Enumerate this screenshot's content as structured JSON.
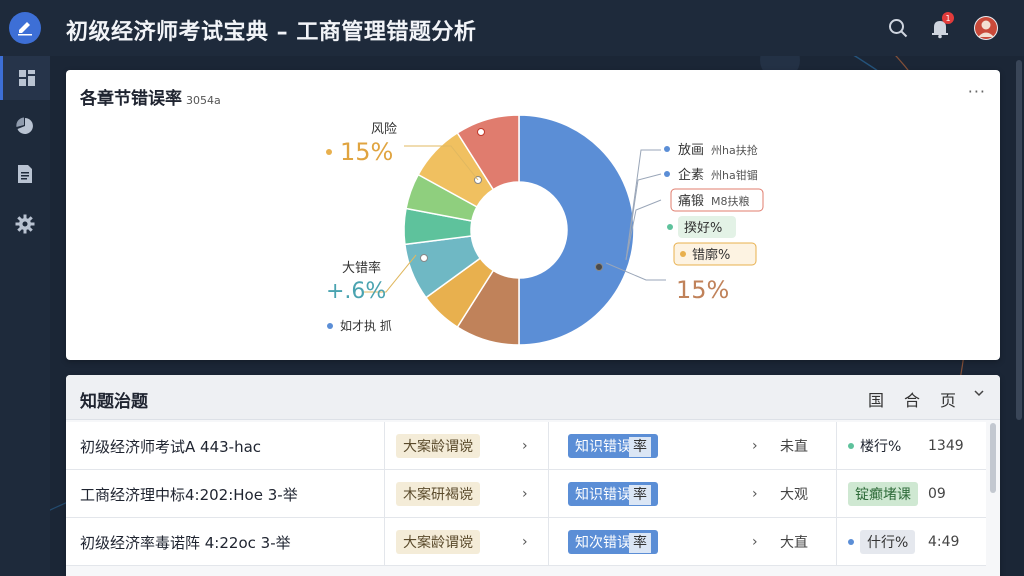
{
  "header": {
    "title": "初级经济师考试宝典 – 工商管理错题分析",
    "notification_count": "1"
  },
  "sidebar": {
    "items": [
      {
        "name": "dashboard",
        "icon": "grid-icon"
      },
      {
        "name": "stats",
        "icon": "pie-icon"
      },
      {
        "name": "documents",
        "icon": "document-icon"
      },
      {
        "name": "settings",
        "icon": "gear-icon"
      }
    ]
  },
  "chart_card": {
    "title": "各章节错误率",
    "subtitle": "3054a",
    "more": "···"
  },
  "chart_data": {
    "type": "pie",
    "donut": true,
    "slices": [
      {
        "value": 50,
        "color": "#5b8ed6"
      },
      {
        "value": 9,
        "color": "#c0825a"
      },
      {
        "value": 6,
        "color": "#e8b04e"
      },
      {
        "value": 8,
        "color": "#6fb8c4"
      },
      {
        "value": 5,
        "color": "#5ec29c"
      },
      {
        "value": 5,
        "color": "#8fcf7e"
      },
      {
        "value": 8,
        "color": "#f0c060"
      },
      {
        "value": 9,
        "color": "#e07c6e"
      }
    ],
    "annotations": {
      "top_left": {
        "name": "风险",
        "value": "15%"
      },
      "mid_left": {
        "name": "大错率",
        "value": "+.6%"
      },
      "bottom_left": {
        "name": "如才执 抓"
      },
      "right_value": "15%"
    },
    "legend": [
      {
        "label": "放画",
        "extra": "州ha扶抢",
        "color": "#5b8ed6"
      },
      {
        "label": "企素",
        "extra": "州ha钳镅"
      },
      {
        "label": "痛锻",
        "extra": "M8扶粮"
      },
      {
        "label": "揆好%",
        "color": "#5ec29c"
      },
      {
        "label": "错廓%",
        "color": "#e8b04e"
      }
    ]
  },
  "table": {
    "title": "知题治题",
    "controls": [
      "国",
      "合",
      "页"
    ],
    "rows": [
      {
        "name": "初级经济师考试A 443-hac",
        "tag1": "大案龄谓谠",
        "tag2_main": "知识错误",
        "tag2_tail": "率",
        "col4": "未直",
        "status": "楼行%",
        "count": "1349"
      },
      {
        "name": "工商经济理中标4:202:Hoe 3-举",
        "tag1": "木案研褐谠",
        "tag2_main": "知识错误",
        "tag2_tail": "率",
        "col4": "大观",
        "status": "锭癫堵课",
        "count": "09"
      },
      {
        "name": "初级经济率毒诺阵 4:22oc 3-举",
        "tag1": "大案龄谓谠",
        "tag2_main": "知次错误",
        "tag2_tail": "率",
        "col4": "大直",
        "status": "什行%",
        "count": "4:49"
      }
    ]
  }
}
